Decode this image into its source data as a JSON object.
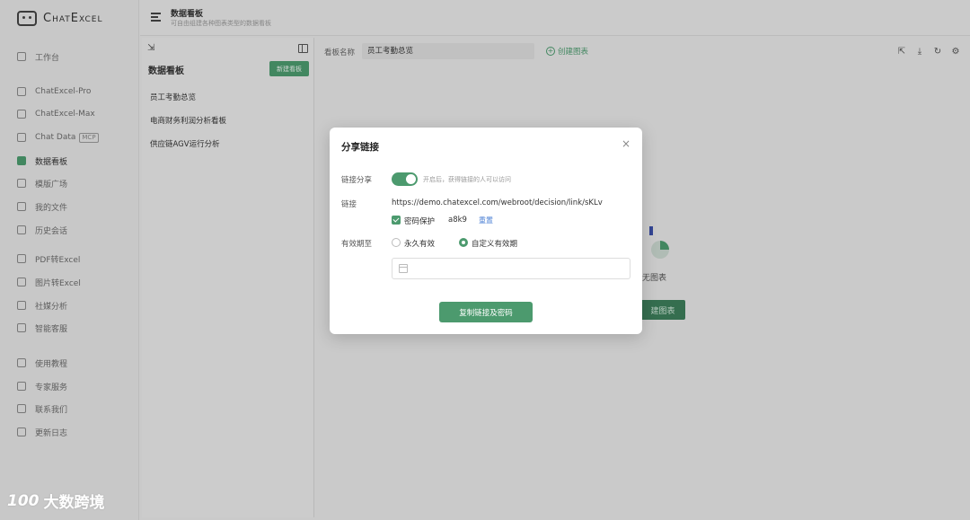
{
  "app": {
    "name": "ChatExcel"
  },
  "sidebar": {
    "items": [
      {
        "label": "工作台",
        "icon": "home-icon"
      },
      {
        "label": "ChatExcel-Pro",
        "icon": "pro-icon"
      },
      {
        "label": "ChatExcel-Max",
        "icon": "max-icon"
      },
      {
        "label": "Chat Data",
        "badge": "MCP",
        "icon": "chat-data-icon"
      },
      {
        "label": "数据看板",
        "icon": "dashboard-icon",
        "active": true
      },
      {
        "label": "模版广场",
        "icon": "template-icon"
      },
      {
        "label": "我的文件",
        "icon": "file-icon"
      },
      {
        "label": "历史会话",
        "icon": "history-icon"
      },
      {
        "label": "PDF转Excel",
        "icon": "pdf-icon"
      },
      {
        "label": "图片转Excel",
        "icon": "image-icon"
      },
      {
        "label": "社媒分析",
        "icon": "social-icon"
      },
      {
        "label": "智能客服",
        "icon": "support-icon"
      },
      {
        "label": "使用教程",
        "icon": "tutorial-icon"
      },
      {
        "label": "专家服务",
        "icon": "expert-icon"
      },
      {
        "label": "联系我们",
        "icon": "contact-icon"
      },
      {
        "label": "更新日志",
        "icon": "changelog-icon"
      }
    ]
  },
  "header": {
    "title": "数据看板",
    "subtitle": "可自由组建各种图表类型的数据看板"
  },
  "panel": {
    "title": "数据看板",
    "new_button": "新建看板",
    "boards": [
      "员工考勤总览",
      "电商财务利润分析看板",
      "供应链AGV运行分析"
    ]
  },
  "main": {
    "board_name_label": "看板名称",
    "board_name_value": "员工考勤总览",
    "create_chart": "创建图表",
    "empty_text": "无图表",
    "empty_button": "建图表"
  },
  "dialog": {
    "title": "分享链接",
    "share_label": "链接分享",
    "share_hint": "开启后，获得链接的人可以访问",
    "share_enabled": true,
    "link_label": "链接",
    "link_url": "https://demo.chatexcel.com/webroot/decision/link/sKLv",
    "password_label": "密码保护",
    "password_value": "a8k9",
    "password_checked": true,
    "reset_label": "重置",
    "expiry_label": "有效期至",
    "expiry_options": [
      "永久有效",
      "自定义有效期"
    ],
    "expiry_selected": "自定义有效期",
    "date_placeholder": "",
    "copy_button": "复制链接及密码",
    "close_symbol": "×"
  },
  "watermark": {
    "logo": "100",
    "text": "大数跨境"
  },
  "colors": {
    "accent": "#4c9a6e",
    "link": "#4a7fd4"
  }
}
